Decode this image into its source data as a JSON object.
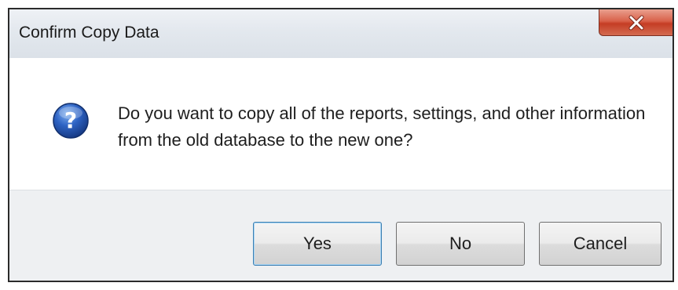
{
  "window": {
    "title": "Confirm Copy Data",
    "close_icon": "close-x-icon"
  },
  "message": {
    "icon": "question-icon",
    "text": "Do you want to copy all of the reports, settings, and other information from the old database to the new one?"
  },
  "buttons": {
    "yes": "Yes",
    "no": "No",
    "cancel": "Cancel"
  },
  "colors": {
    "close_button": "#c9442b",
    "question_icon": "#1f4fa8",
    "footer_background": "#eef0f2"
  }
}
